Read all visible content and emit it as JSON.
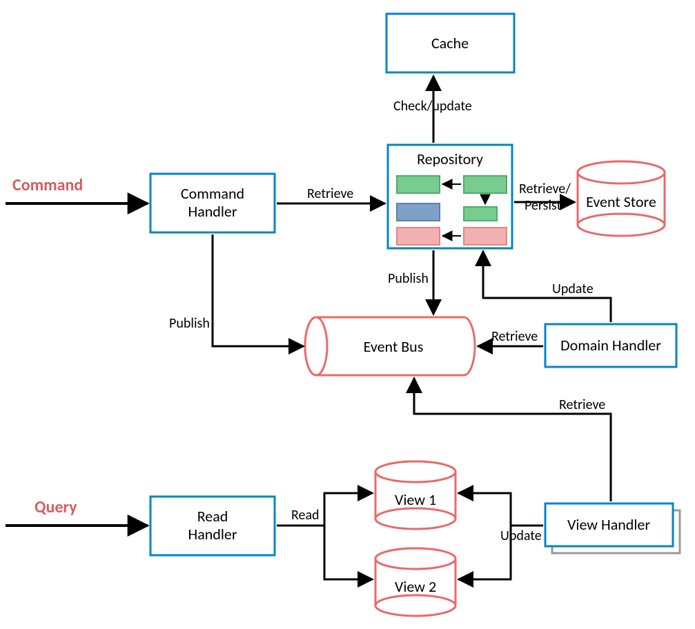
{
  "entries": {
    "command": "Command",
    "query": "Query"
  },
  "nodes": {
    "cache": "Cache",
    "commandHandler": "Command\nHandler",
    "repository": "Repository",
    "eventStore": "Event Store",
    "eventBus": "Event Bus",
    "domainHandler": "Domain Handler",
    "readHandler": "Read\nHandler",
    "view1": "View 1",
    "view2": "View 2",
    "viewHandler": "View Handler"
  },
  "edges": {
    "repoCache": "Check/update",
    "cmdRepo": "Retrieve",
    "repoStore": "Retrieve/\nPersist",
    "repoBus": "Publish",
    "cmdBus": "Publish",
    "domainBus": "Retrieve",
    "domainRepo": "Update",
    "viewBusRetrieve": "Retrieve",
    "readView": "Read",
    "viewUpdate": "Update"
  },
  "colors": {
    "boxStroke": "#0086c8",
    "redStroke": "#e96a6a",
    "green": "#77cc8f",
    "blue": "#7fa0c9",
    "pink": "#f3b0b0",
    "arrow": "#000000"
  }
}
